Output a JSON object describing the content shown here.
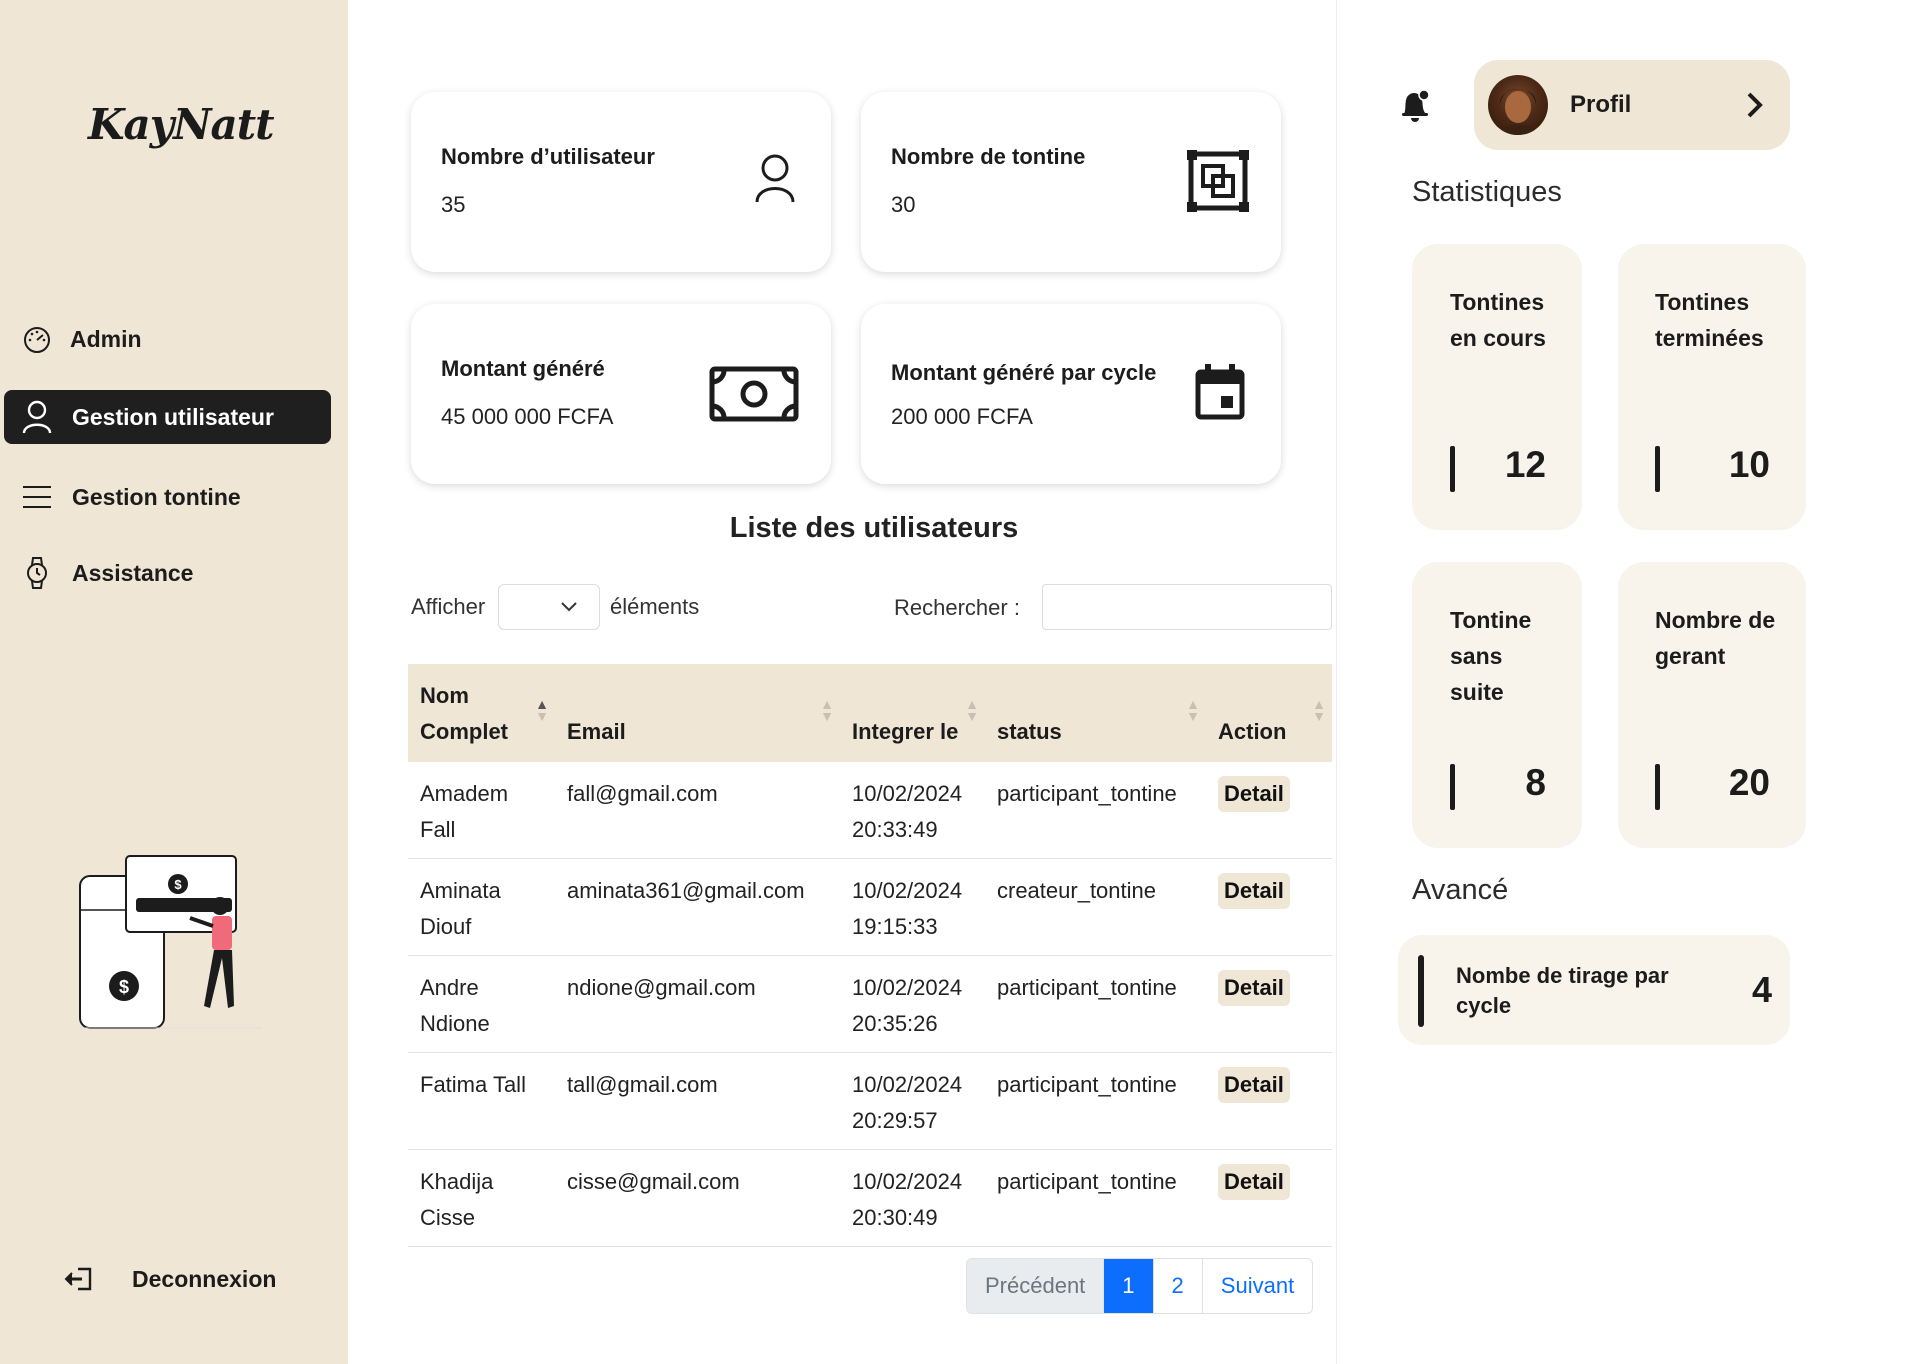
{
  "sidebar": {
    "logo": "KayNatt",
    "items": [
      {
        "label": "Admin",
        "icon": "dashboard-gauge-icon"
      },
      {
        "label": "Gestion utilisateur",
        "icon": "user-icon",
        "active": true
      },
      {
        "label": "Gestion tontine",
        "icon": "menu-lines-icon"
      },
      {
        "label": "Assistance",
        "icon": "watch-icon"
      }
    ],
    "logout_label": "Deconnexion"
  },
  "cards": [
    {
      "title": "Nombre d’utilisateur",
      "value": "35",
      "icon": "user-icon"
    },
    {
      "title": "Nombre de tontine",
      "value": "30",
      "icon": "frame-squares-icon"
    },
    {
      "title": "Montant généré",
      "value": "45 000 000 FCFA",
      "icon": "banknote-icon"
    },
    {
      "title": "Montant généré par cycle",
      "value": "200 000 FCFA",
      "icon": "calendar-icon"
    }
  ],
  "list": {
    "title": "Liste des utilisateurs",
    "show_label": "Afficher",
    "elements_label": "éléments",
    "search_label": "Rechercher :",
    "search_value": "",
    "columns": [
      "Nom Complet",
      "Email",
      "Integrer le",
      "status",
      "Action"
    ],
    "rows": [
      {
        "name": "Amadem Fall",
        "email": "fall@gmail.com",
        "date": "10/02/2024 20:33:49",
        "status": "participant_tontine",
        "action": "Detail"
      },
      {
        "name": "Aminata Diouf",
        "email": "aminata361@gmail.com",
        "date": "10/02/2024 19:15:33",
        "status": "createur_tontine",
        "action": "Detail"
      },
      {
        "name": "Andre Ndione",
        "email": "ndione@gmail.com",
        "date": "10/02/2024 20:35:26",
        "status": "participant_tontine",
        "action": "Detail"
      },
      {
        "name": "Fatima Tall",
        "email": "tall@gmail.com",
        "date": "10/02/2024 20:29:57",
        "status": "participant_tontine",
        "action": "Detail"
      },
      {
        "name": "Khadija Cisse",
        "email": "cisse@gmail.com",
        "date": "10/02/2024 20:30:49",
        "status": "participant_tontine",
        "action": "Detail"
      }
    ],
    "pagination": {
      "prev": "Précédent",
      "pages": [
        "1",
        "2"
      ],
      "current": "1",
      "next": "Suivant"
    }
  },
  "right": {
    "profile_label": "Profil",
    "stats_title": "Statistiques",
    "stats": [
      {
        "label": "Tontines en cours",
        "value": "12"
      },
      {
        "label": "Tontines terminées",
        "value": "10"
      },
      {
        "label": "Tontine sans suite",
        "value": "8"
      },
      {
        "label": "Nombre de gerant",
        "value": "20"
      }
    ],
    "advanced_title": "Avancé",
    "advanced": {
      "label": "Nombe de tirage par cycle",
      "value": "4"
    }
  },
  "colors": {
    "sidebar_bg": "#efe6d6",
    "card_bg": "#f8f4ec",
    "active_nav": "#1f1f1f",
    "primary": "#0d6efd"
  }
}
